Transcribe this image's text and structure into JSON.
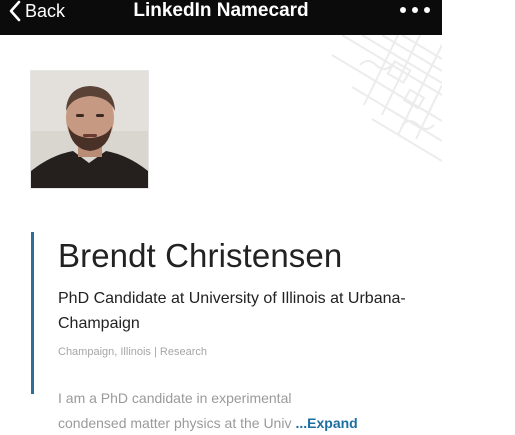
{
  "navbar": {
    "back_label": "Back",
    "title": "LinkedIn Namecard",
    "back_icon": "chevron-left-icon",
    "more_icon": "more-horizontal-icon"
  },
  "profile": {
    "name": "Brendt Christensen",
    "headline": "PhD Candidate at University of Illinois at Urbana-Champaign",
    "location_industry": "Champaign, Illinois | Research",
    "summary_line_1": "I am a PhD candidate in experimental",
    "summary_line_2": "condensed matter physics at the Univ",
    "expand_label": "...Expand"
  },
  "colors": {
    "navbar_bg": "#0b0b0b",
    "accent": "#2e6f9a",
    "link": "#1b6fa0"
  }
}
